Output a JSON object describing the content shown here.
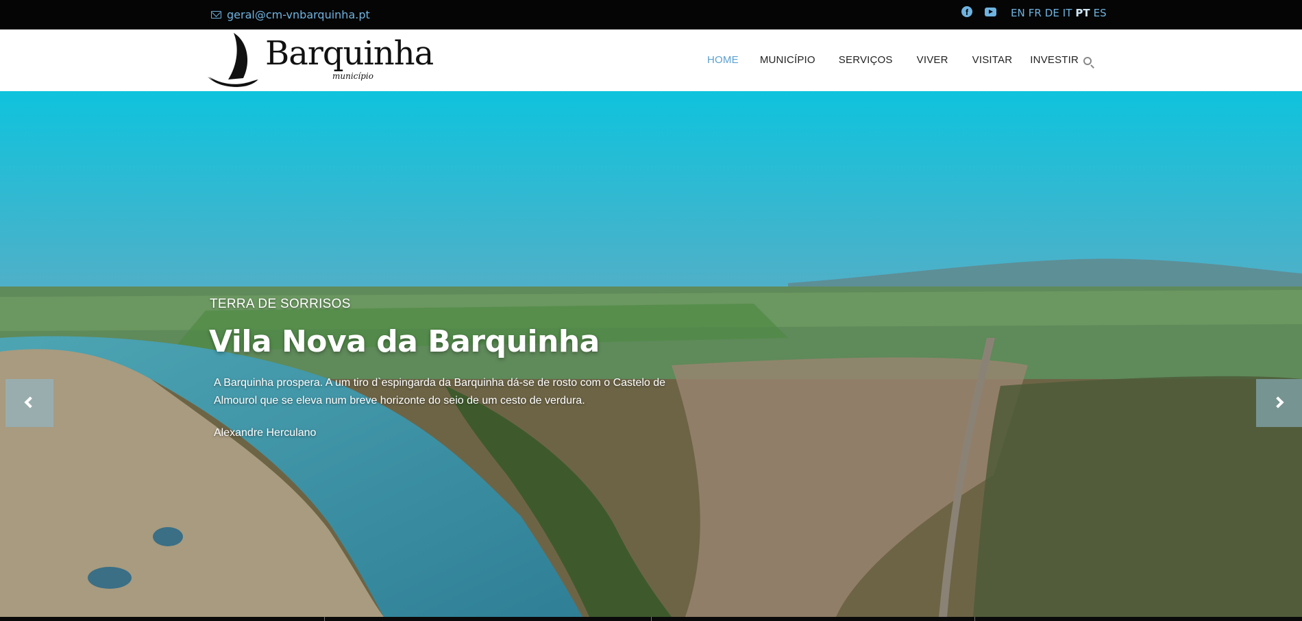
{
  "topbar": {
    "email": "geral@cm-vnbarquinha.pt",
    "social": [
      "facebook-icon",
      "youtube-icon"
    ],
    "languages": [
      "EN",
      "FR",
      "DE",
      "IT",
      "PT",
      "ES"
    ],
    "active_language": "PT"
  },
  "header": {
    "logo_name": "Barquinha",
    "logo_sub": "município",
    "nav": [
      "HOME",
      "MUNICÍPIO",
      "SERVIÇOS",
      "VIVER",
      "VISITAR",
      "INVESTIR"
    ],
    "active_nav": "HOME",
    "search_icon": "search-icon"
  },
  "hero": {
    "subtitle": "TERRA DE SORRISOS",
    "title": "Vila Nova da Barquinha",
    "quote": "A Barquinha prospera. A um tiro d`espingarda da Barquinha dá-se de rosto com o Castelo de Almourol que se eleva num breve horizonte do seio de um cesto de verdura.",
    "author": "Alexandre Herculano"
  },
  "colors": {
    "accent": "#5aa0d2",
    "topbar_bg": "#050505",
    "link": "#6fb3e0"
  }
}
